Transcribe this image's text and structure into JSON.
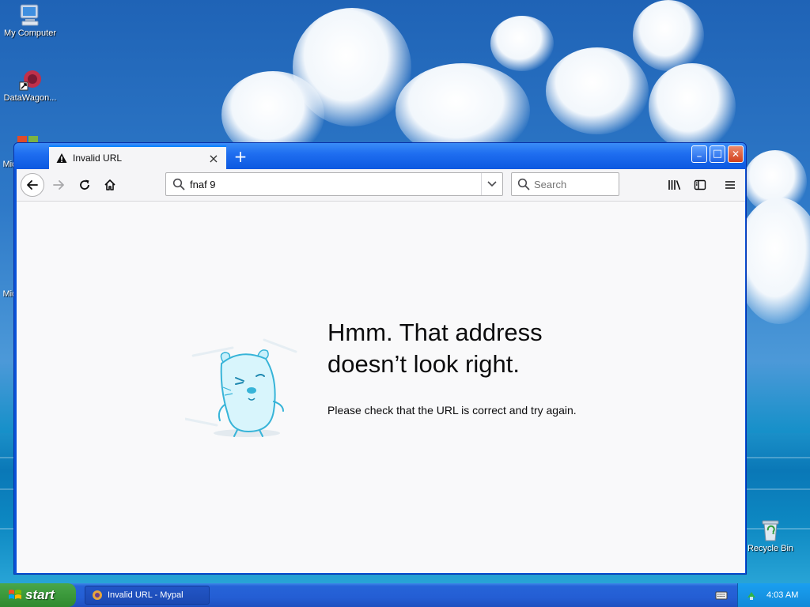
{
  "desktop": {
    "icons": [
      {
        "label": "My Computer"
      },
      {
        "label": "DataWagon..."
      },
      {
        "label": "Mic"
      },
      {
        "label": "Mic"
      },
      {
        "label": "Recycle Bin"
      }
    ]
  },
  "browser": {
    "tab": {
      "title": "Invalid URL",
      "close_icon": "×"
    },
    "new_tab_label": "+",
    "window_controls": {
      "minimize": "_",
      "maximize": "□",
      "close": "✕"
    },
    "url_bar": {
      "value": "fnaf 9"
    },
    "search_bar": {
      "placeholder": "Search"
    },
    "error_page": {
      "heading": "Hmm. That address doesn’t look right.",
      "description": "Please check that the URL is correct and try again."
    }
  },
  "taskbar": {
    "start_label": "start",
    "task_item": "Invalid URL - Mypal",
    "clock": "4:03 AM"
  },
  "colors": {
    "accent": "#0a84ff",
    "xp_titlebar": "#0b58e0",
    "start_green": "#3c9a3c"
  }
}
